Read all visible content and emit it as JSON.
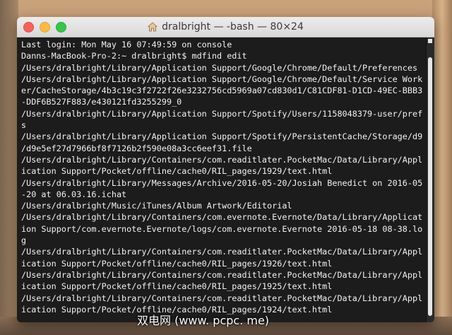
{
  "window": {
    "title": "dralbright — -bash — 80×24"
  },
  "terminal": {
    "lines": [
      "Last login: Mon May 16 07:49:59 on console",
      "Danns-MacBook-Pro-2:~ dralbright$ mdfind edit",
      "/Users/dralbright/Library/Application Support/Google/Chrome/Default/Preferences",
      "/Users/dralbright/Library/Application Support/Google/Chrome/Default/Service Work",
      "er/CacheStorage/4b3c19c3f2722f26e3232756cd5969a07cd830d1/C81CDF81-D1CD-49EC-BBB3",
      "-DDF6B527F883/e430121fd3255299_0",
      "/Users/dralbright/Library/Application Support/Spotify/Users/1158048379-user/pref",
      "s",
      "/Users/dralbright/Library/Application Support/Spotify/PersistentCache/Storage/d9",
      "/d9e5ef27d7966bf8f7126b2f590e08a3cc6eef31.file",
      "/Users/dralbright/Library/Containers/com.readitlater.PocketMac/Data/Library/Appl",
      "ication Support/Pocket/offline/cache0/RIL_pages/1929/text.html",
      "/Users/dralbright/Library/Messages/Archive/2016-05-20/Josiah Benedict on 2016-05",
      "-20 at 06.03.16.ichat",
      "/Users/dralbright/Music/iTunes/Album Artwork/Editorial",
      "/Users/dralbright/Library/Containers/com.evernote.Evernote/Data/Library/Applicat",
      "ion Support/com.evernote.Evernote/logs/com.evernote.Evernote 2016-05-18 08-38.lo",
      "g",
      "/Users/dralbright/Library/Containers/com.readitlater.PocketMac/Data/Library/Appl",
      "ication Support/Pocket/offline/cache0/RIL_pages/1926/text.html",
      "/Users/dralbright/Library/Containers/com.readitlater.PocketMac/Data/Library/Appl",
      "ication Support/Pocket/offline/cache0/RIL_pages/1925/text.html",
      "/Users/dralbright/Library/Containers/com.readitlater.PocketMac/Data/Library/Appl",
      "ication Support/Pocket/offline/cache0/RIL_pages/1924/text.html"
    ]
  },
  "watermark": "双电网 (www. pcpc. me)",
  "colors": {
    "terminal_bg": "#1c1c1c",
    "terminal_fg": "#f2f2f2",
    "close": "#fc605c",
    "minimize": "#fdbc40",
    "maximize": "#34c84a"
  },
  "icons": {
    "title": "house-icon"
  }
}
